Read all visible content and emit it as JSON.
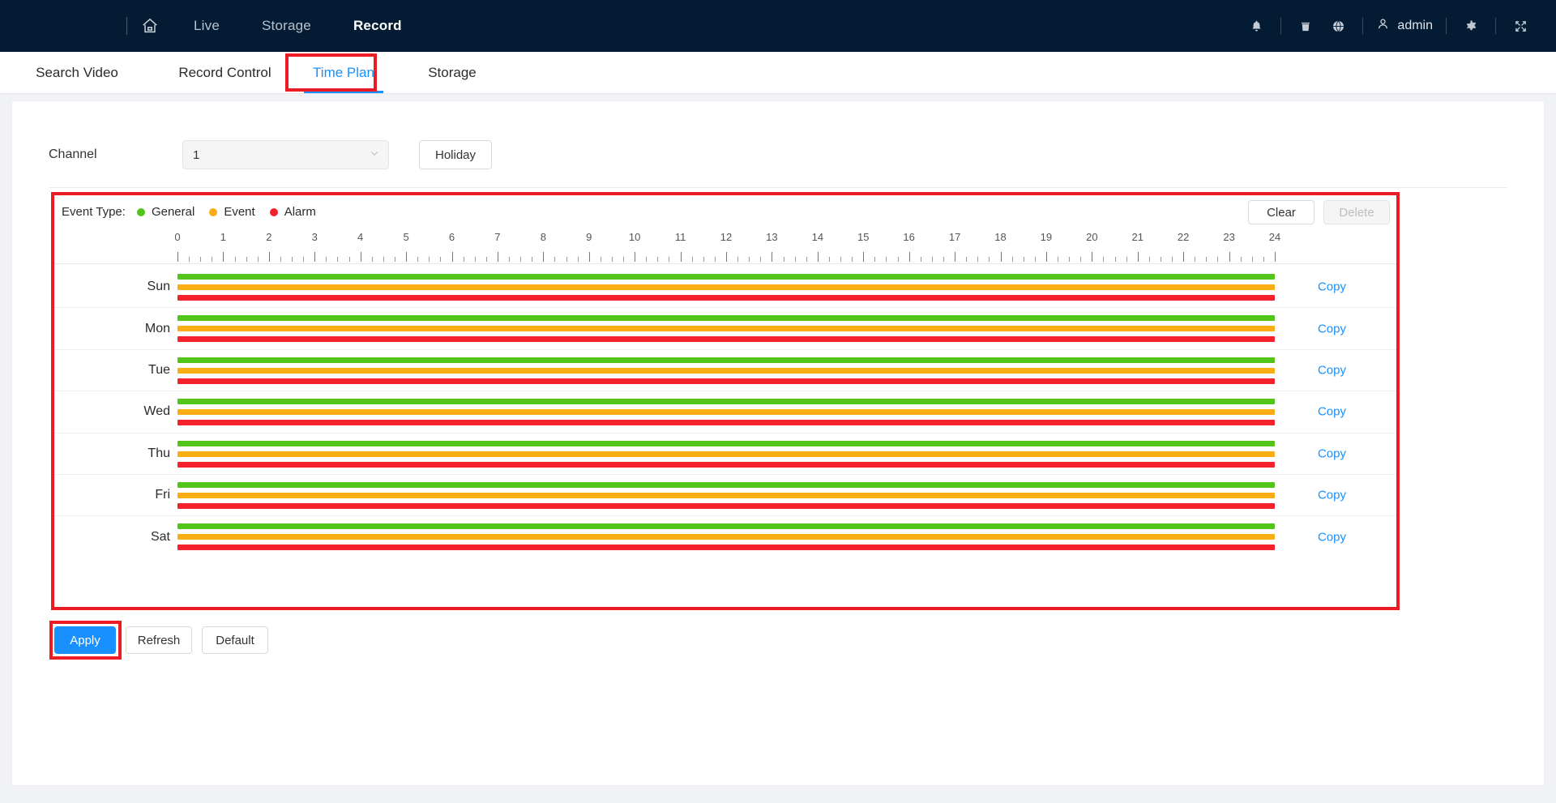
{
  "header": {
    "home_icon": "home-icon",
    "nav": [
      {
        "label": "Live",
        "active": false
      },
      {
        "label": "Storage",
        "active": false
      },
      {
        "label": "Record",
        "active": true
      }
    ],
    "right_icons": [
      {
        "name": "bell-icon"
      },
      {
        "name": "trash-icon"
      },
      {
        "name": "globe-icon"
      }
    ],
    "user": {
      "icon": "user-icon",
      "name": "admin"
    },
    "settings_icon": "gear-icon",
    "fullscreen_icon": "fullscreen-icon"
  },
  "subtabs": [
    {
      "label": "Search Video",
      "active": false
    },
    {
      "label": "Record Control",
      "active": false
    },
    {
      "label": "Time Plan",
      "active": true
    },
    {
      "label": "Storage",
      "active": false
    }
  ],
  "form": {
    "channel_label": "Channel",
    "channel_value": "1",
    "channel_caret": "chevron-down-icon",
    "holiday_button": "Holiday"
  },
  "schedule": {
    "legend_title": "Event Type:",
    "legend": [
      {
        "label": "General",
        "color": "#52c41a"
      },
      {
        "label": "Event",
        "color": "#faad14"
      },
      {
        "label": "Alarm",
        "color": "#f5222d"
      }
    ],
    "clear_button": "Clear",
    "delete_button": "Delete",
    "delete_disabled": true,
    "copy_label": "Copy",
    "ruler": {
      "ticks": [
        "0",
        "1",
        "2",
        "3",
        "4",
        "5",
        "6",
        "7",
        "8",
        "9",
        "10",
        "11",
        "12",
        "13",
        "14",
        "15",
        "16",
        "17",
        "18",
        "19",
        "20",
        "21",
        "22",
        "23",
        "24"
      ],
      "minor_per_hour": 4
    },
    "rows": [
      {
        "day": "Sun",
        "bars": [
          {
            "type": "General",
            "color": "#52c41a",
            "start": 0,
            "end": 24
          },
          {
            "type": "Event",
            "color": "#faad14",
            "start": 0,
            "end": 24
          },
          {
            "type": "Alarm",
            "color": "#f5222d",
            "start": 0,
            "end": 24
          }
        ]
      },
      {
        "day": "Mon",
        "bars": [
          {
            "type": "General",
            "color": "#52c41a",
            "start": 0,
            "end": 24
          },
          {
            "type": "Event",
            "color": "#faad14",
            "start": 0,
            "end": 24
          },
          {
            "type": "Alarm",
            "color": "#f5222d",
            "start": 0,
            "end": 24
          }
        ]
      },
      {
        "day": "Tue",
        "bars": [
          {
            "type": "General",
            "color": "#52c41a",
            "start": 0,
            "end": 24
          },
          {
            "type": "Event",
            "color": "#faad14",
            "start": 0,
            "end": 24
          },
          {
            "type": "Alarm",
            "color": "#f5222d",
            "start": 0,
            "end": 24
          }
        ]
      },
      {
        "day": "Wed",
        "bars": [
          {
            "type": "General",
            "color": "#52c41a",
            "start": 0,
            "end": 24
          },
          {
            "type": "Event",
            "color": "#faad14",
            "start": 0,
            "end": 24
          },
          {
            "type": "Alarm",
            "color": "#f5222d",
            "start": 0,
            "end": 24
          }
        ]
      },
      {
        "day": "Thu",
        "bars": [
          {
            "type": "General",
            "color": "#52c41a",
            "start": 0,
            "end": 24
          },
          {
            "type": "Event",
            "color": "#faad14",
            "start": 0,
            "end": 24
          },
          {
            "type": "Alarm",
            "color": "#f5222d",
            "start": 0,
            "end": 24
          }
        ]
      },
      {
        "day": "Fri",
        "bars": [
          {
            "type": "General",
            "color": "#52c41a",
            "start": 0,
            "end": 24
          },
          {
            "type": "Event",
            "color": "#faad14",
            "start": 0,
            "end": 24
          },
          {
            "type": "Alarm",
            "color": "#f5222d",
            "start": 0,
            "end": 24
          }
        ]
      },
      {
        "day": "Sat",
        "bars": [
          {
            "type": "General",
            "color": "#52c41a",
            "start": 0,
            "end": 24
          },
          {
            "type": "Event",
            "color": "#faad14",
            "start": 0,
            "end": 24
          },
          {
            "type": "Alarm",
            "color": "#f5222d",
            "start": 0,
            "end": 24
          }
        ]
      }
    ]
  },
  "footer": {
    "apply": "Apply",
    "refresh": "Refresh",
    "default": "Default"
  },
  "annotations": {
    "highlight_color": "#ed1c24",
    "boxes": [
      "time-plan-tab",
      "schedule-panel",
      "apply-button"
    ]
  }
}
